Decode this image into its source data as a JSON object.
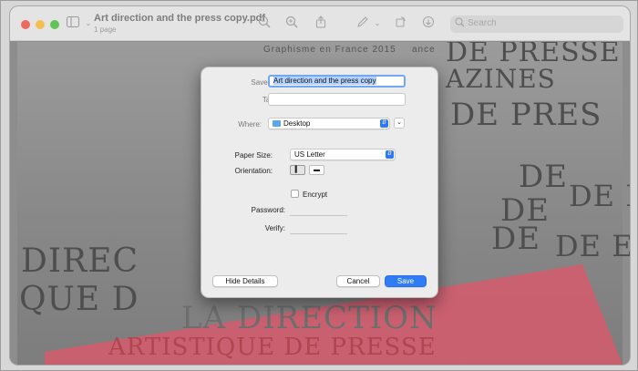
{
  "window": {
    "doc_title": "Art direction and the press copy.pdf",
    "doc_subtitle": "1 page",
    "search_placeholder": "Search",
    "icons": [
      "sidebar-toggle-icon",
      "chevron-down-icon",
      "zoom-out-icon",
      "zoom-in-icon",
      "share-icon",
      "markup-pen-icon",
      "rotate-icon",
      "annotate-circle-icon"
    ]
  },
  "page_background": {
    "lines": [
      "Graphisme en France 2015",
      "ance",
      "DE PRESSE",
      "AZINES",
      "DE PRES",
      "DE",
      "DE",
      "DE E",
      "DE",
      "DE E",
      "DIREC",
      "QUE D",
      "LA DIRECTION",
      "ARTISTIQUE DE PRESSE"
    ],
    "accent_color": "#d9596c"
  },
  "dialog": {
    "save_as_label": "Save As:",
    "save_as_value": "Art direction and the press copy",
    "tags_label": "Tags:",
    "tags_value": "",
    "where_label": "Where:",
    "where_value": "Desktop",
    "paper_size_label": "Paper Size:",
    "paper_size_value": "US Letter",
    "orientation_label": "Orientation:",
    "orientation_portrait": "▍",
    "orientation_landscape": "▬",
    "encrypt_label": "Encrypt",
    "encrypt_checked": false,
    "password_label": "Password:",
    "password_value": "",
    "verify_label": "Verify:",
    "verify_value": "",
    "hide_details_label": "Hide Details",
    "cancel_label": "Cancel",
    "save_label": "Save",
    "accent_color": "#2f7cf6"
  }
}
